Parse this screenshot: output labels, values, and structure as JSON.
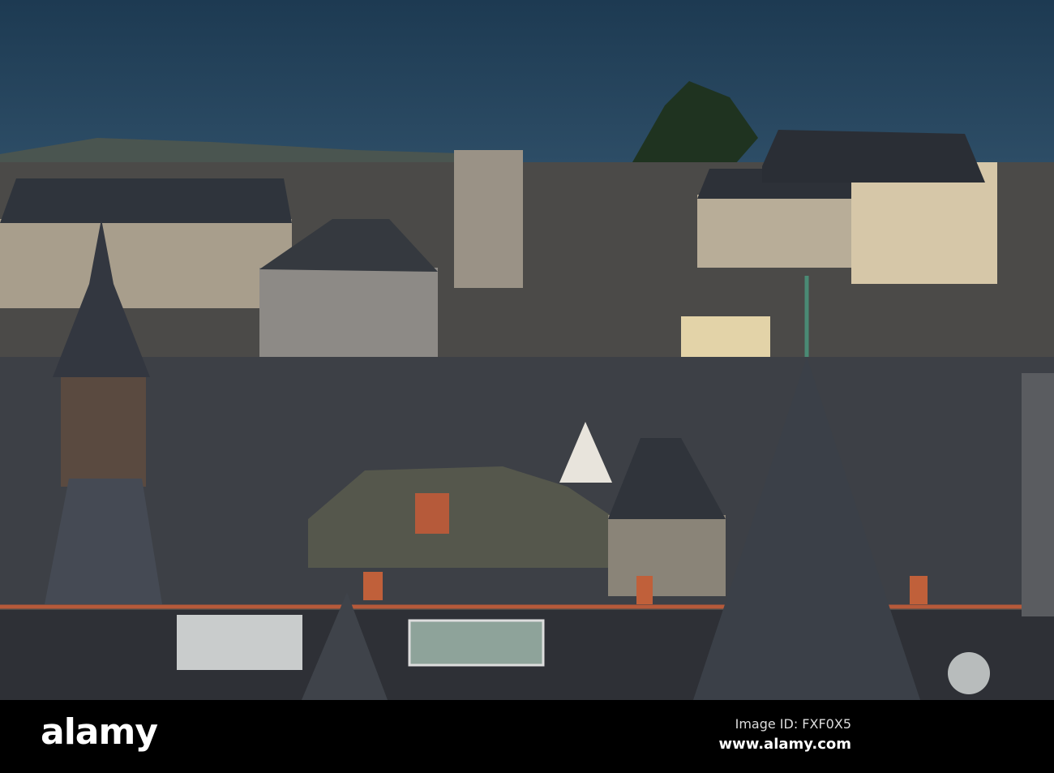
{
  "photo": {
    "subject": "Rooftops of an old town with slate roofs and spires",
    "colors": {
      "sky": "#1f3d55",
      "slate": "#3a3f47",
      "stone": "#9a9080",
      "sunlit": "#d8c6a0",
      "chimney": "#b65a3a"
    }
  },
  "watermark": {
    "brand": "alamy"
  },
  "footer": {
    "logo": "alamy",
    "image_id": "Image ID: FXF0X5",
    "site": "www.alamy.com"
  }
}
